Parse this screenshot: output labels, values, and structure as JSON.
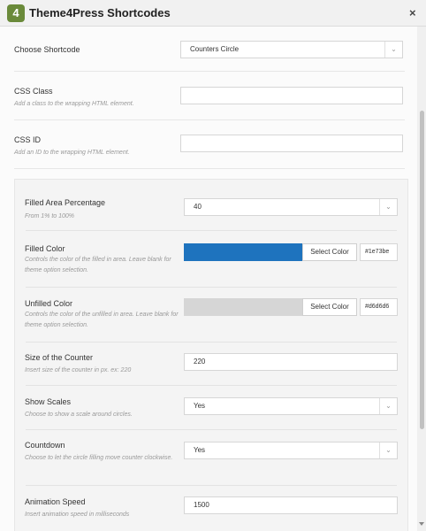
{
  "app": {
    "title": "Theme4Press Shortcodes",
    "logo_text": "4",
    "close_glyph": "×"
  },
  "choose": {
    "label": "Choose Shortcode",
    "value": "Counters Circle"
  },
  "css_class": {
    "label": "CSS Class",
    "description": "Add a class to the wrapping HTML element.",
    "value": ""
  },
  "css_id": {
    "label": "CSS ID",
    "description": "Add an ID to the wrapping HTML element.",
    "value": ""
  },
  "filled_pct": {
    "label": "Filled Area Percentage",
    "description": "From 1% to 100%",
    "value": "40"
  },
  "filled_color": {
    "label": "Filled Color",
    "description": "Controls the color of the filled in area. Leave blank for theme option selection.",
    "button": "Select Color",
    "hex": "#1e73be",
    "color": "#1e73be"
  },
  "unfilled_color": {
    "label": "Unfilled Color",
    "description": "Controls the color of the unfilled in area. Leave blank for theme option selection.",
    "button": "Select Color",
    "hex": "#d6d6d6",
    "color": "#d6d6d6"
  },
  "size": {
    "label": "Size of the Counter",
    "description": "Insert size of the counter in px. ex: 220",
    "value": "220"
  },
  "scales": {
    "label": "Show Scales",
    "description": "Choose to show a scale around circles.",
    "value": "Yes"
  },
  "countdown": {
    "label": "Countdown",
    "description": "Choose to let the circle filling move counter clockwise.",
    "value": "Yes"
  },
  "speed": {
    "label": "Animation Speed",
    "description": "Insert animation speed in milliseconds",
    "value": "1500"
  }
}
